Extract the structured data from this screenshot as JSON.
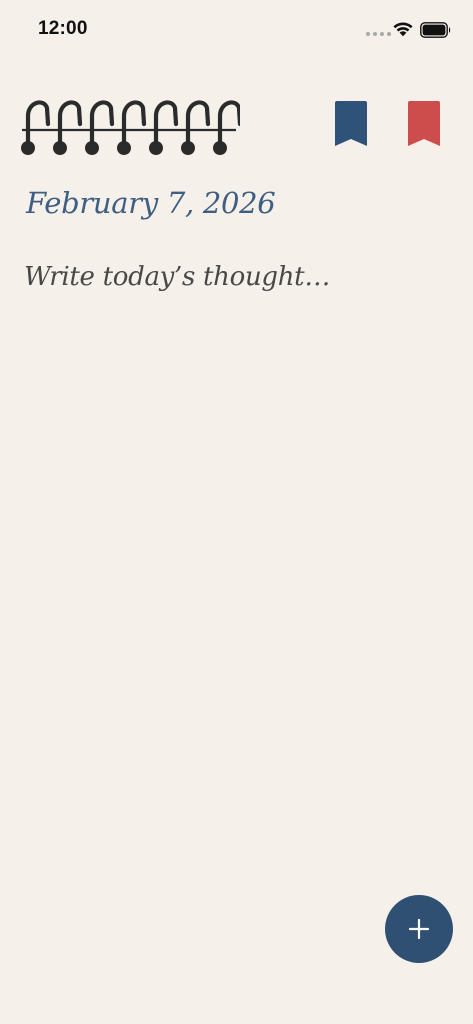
{
  "status_bar": {
    "time": "12:00"
  },
  "journal": {
    "date": "February 7, 2026",
    "text_value": "",
    "placeholder": "Write today’s thought…"
  },
  "bookmarks": [
    {
      "name": "bookmark-blue-icon",
      "color": "#2f5278"
    },
    {
      "name": "bookmark-red-icon",
      "color": "#cd4d4d"
    }
  ],
  "icons": {
    "spiral": "spiral-binding-icon",
    "wifi": "wifi-icon",
    "battery": "battery-icon",
    "add": "plus-icon"
  },
  "colors": {
    "background": "#f6f0ea",
    "date": "#3e5e82",
    "text": "#4a4846",
    "fab": "#2f4f73",
    "spiral": "#2b2b2b"
  }
}
